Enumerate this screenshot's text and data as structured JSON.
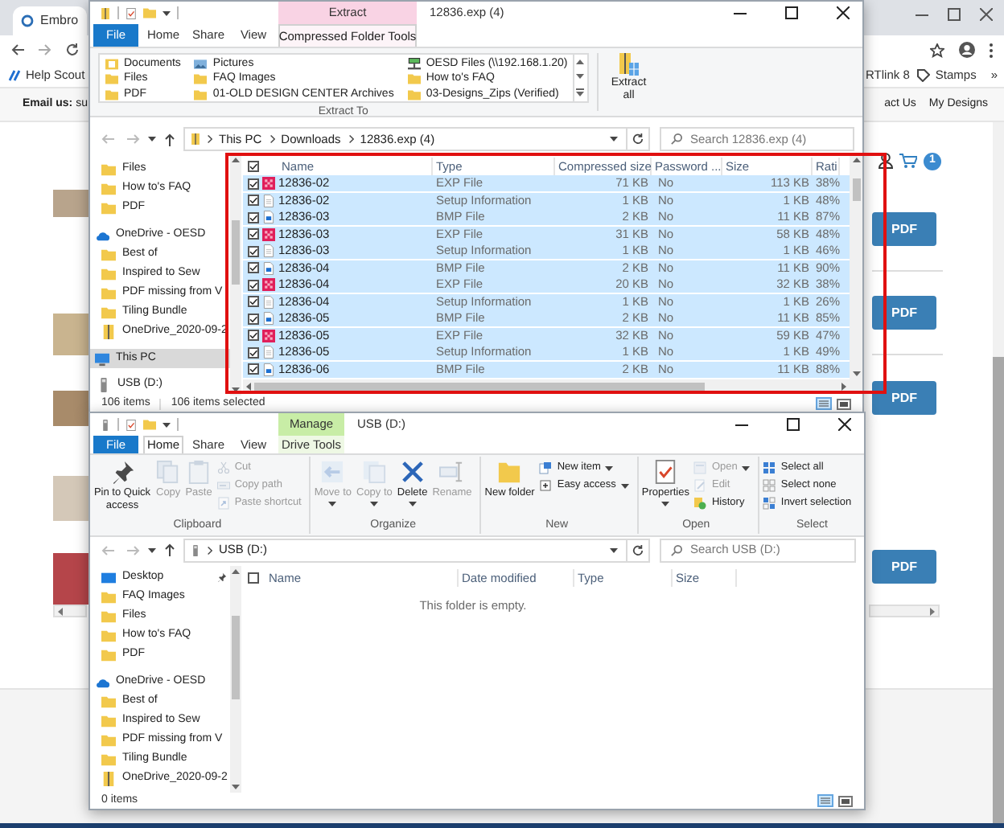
{
  "browser": {
    "tab_title": "Embro",
    "bookmarks_left": [
      "Help Scout"
    ],
    "bookmarks_right": [
      "RTlink 8",
      "Stamps"
    ],
    "bookmarks_more": "»",
    "email_label": "**Email us:** su",
    "nav_links": [
      "act Us",
      "My Designs"
    ],
    "cart_count": "1",
    "pdf_buttons": [
      "PDF",
      "PDF",
      "PDF",
      "PDF"
    ]
  },
  "zip_window": {
    "title": "12836.exp (4)",
    "context_group": "Extract",
    "tabs": [
      {
        "label": "File",
        "kind": "file",
        "selected": false
      },
      {
        "label": "Home",
        "kind": "plain",
        "selected": false
      },
      {
        "label": "Share",
        "kind": "plain",
        "selected": false
      },
      {
        "label": "View",
        "kind": "plain",
        "selected": false
      },
      {
        "label": "Compressed Folder Tools",
        "kind": "context",
        "selected": true
      }
    ],
    "extract_to": [
      {
        "label": "Documents",
        "kind": "documents"
      },
      {
        "label": "Pictures",
        "kind": "pictures"
      },
      {
        "label": "OESD Files (\\\\192.168.1.20)",
        "kind": "network"
      },
      {
        "label": "Files",
        "kind": "folder"
      },
      {
        "label": "FAQ Images",
        "kind": "folder"
      },
      {
        "label": "How to's FAQ",
        "kind": "folder"
      },
      {
        "label": "PDF",
        "kind": "folder"
      },
      {
        "label": "01-OLD DESIGN CENTER Archives",
        "kind": "folder"
      },
      {
        "label": "03-Designs_Zips (Verified)",
        "kind": "folder"
      }
    ],
    "extract_to_label": "Extract To",
    "extract_all": "Extract all",
    "breadcrumb": [
      "This PC",
      "Downloads",
      "12836.exp (4)"
    ],
    "search_placeholder": "Search 12836.exp (4)",
    "nav_items": [
      {
        "label": "Files",
        "kind": "folder",
        "selected": false
      },
      {
        "label": "How to's FAQ",
        "kind": "folder",
        "selected": false
      },
      {
        "label": "PDF",
        "kind": "folder",
        "selected": false
      },
      {
        "label": "OneDrive - OESD",
        "kind": "cloud",
        "selected": false
      },
      {
        "label": "Best of",
        "kind": "folder",
        "selected": false
      },
      {
        "label": "Inspired to Sew",
        "kind": "folder",
        "selected": false
      },
      {
        "label": "PDF missing from V",
        "kind": "folder",
        "selected": false
      },
      {
        "label": "Tiling Bundle",
        "kind": "folder",
        "selected": false
      },
      {
        "label": "OneDrive_2020-09-2",
        "kind": "zip",
        "selected": false
      },
      {
        "label": "This PC",
        "kind": "pc",
        "selected": true
      },
      {
        "label": "USB (D:)",
        "kind": "drive",
        "selected": false
      }
    ],
    "header_checked": true,
    "columns": [
      "Name",
      "Type",
      "Compressed size",
      "Password ...",
      "Size",
      "Rati"
    ],
    "rows": [
      {
        "kind": "exp",
        "name": "12836-02",
        "type": "EXP File",
        "compressed_size": "71 KB",
        "password": "No",
        "size": "113 KB",
        "ratio": "38%",
        "checked": true,
        "selected": true
      },
      {
        "kind": "setup",
        "name": "12836-02",
        "type": "Setup Information",
        "compressed_size": "1 KB",
        "password": "No",
        "size": "1 KB",
        "ratio": "48%",
        "checked": true,
        "selected": true
      },
      {
        "kind": "bmp",
        "name": "12836-03",
        "type": "BMP File",
        "compressed_size": "2 KB",
        "password": "No",
        "size": "11 KB",
        "ratio": "87%",
        "checked": true,
        "selected": true
      },
      {
        "kind": "exp",
        "name": "12836-03",
        "type": "EXP File",
        "compressed_size": "31 KB",
        "password": "No",
        "size": "58 KB",
        "ratio": "48%",
        "checked": true,
        "selected": true
      },
      {
        "kind": "setup",
        "name": "12836-03",
        "type": "Setup Information",
        "compressed_size": "1 KB",
        "password": "No",
        "size": "1 KB",
        "ratio": "46%",
        "checked": true,
        "selected": true
      },
      {
        "kind": "bmp",
        "name": "12836-04",
        "type": "BMP File",
        "compressed_size": "2 KB",
        "password": "No",
        "size": "11 KB",
        "ratio": "90%",
        "checked": true,
        "selected": true
      },
      {
        "kind": "exp",
        "name": "12836-04",
        "type": "EXP File",
        "compressed_size": "20 KB",
        "password": "No",
        "size": "32 KB",
        "ratio": "38%",
        "checked": true,
        "selected": true
      },
      {
        "kind": "setup",
        "name": "12836-04",
        "type": "Setup Information",
        "compressed_size": "1 KB",
        "password": "No",
        "size": "1 KB",
        "ratio": "26%",
        "checked": true,
        "selected": true
      },
      {
        "kind": "bmp",
        "name": "12836-05",
        "type": "BMP File",
        "compressed_size": "2 KB",
        "password": "No",
        "size": "11 KB",
        "ratio": "85%",
        "checked": true,
        "selected": true
      },
      {
        "kind": "exp",
        "name": "12836-05",
        "type": "EXP File",
        "compressed_size": "32 KB",
        "password": "No",
        "size": "59 KB",
        "ratio": "47%",
        "checked": true,
        "selected": true
      },
      {
        "kind": "setup",
        "name": "12836-05",
        "type": "Setup Information",
        "compressed_size": "1 KB",
        "password": "No",
        "size": "1 KB",
        "ratio": "49%",
        "checked": true,
        "selected": true
      },
      {
        "kind": "bmp",
        "name": "12836-06",
        "type": "BMP File",
        "compressed_size": "2 KB",
        "password": "No",
        "size": "11 KB",
        "ratio": "88%",
        "checked": true,
        "selected": true
      }
    ],
    "item_count": "106 items",
    "selected_count": "106 items selected"
  },
  "usb_window": {
    "title": "USB (D:)",
    "context_group": "Manage",
    "tabs": [
      {
        "label": "File",
        "kind": "file",
        "selected": false
      },
      {
        "label": "Home",
        "kind": "plain",
        "selected": true
      },
      {
        "label": "Share",
        "kind": "plain",
        "selected": false
      },
      {
        "label": "View",
        "kind": "plain",
        "selected": false
      },
      {
        "label": "Drive Tools",
        "kind": "context",
        "selected": false
      }
    ],
    "ribbon_groups": [
      {
        "label": "Clipboard",
        "buttons": [
          {
            "label": "Pin to Quick access",
            "kind": "large",
            "disabled": false,
            "dropdown": false
          },
          {
            "label": "Copy",
            "kind": "large",
            "disabled": true,
            "dropdown": false
          },
          {
            "label": "Paste",
            "kind": "large",
            "disabled": true,
            "dropdown": false
          },
          {
            "label": "Cut",
            "kind": "small",
            "disabled": true,
            "dropdown": false
          },
          {
            "label": "Copy path",
            "kind": "small",
            "disabled": true,
            "dropdown": false
          },
          {
            "label": "Paste shortcut",
            "kind": "small",
            "disabled": true,
            "dropdown": false
          }
        ]
      },
      {
        "label": "Organize",
        "buttons": [
          {
            "label": "Move to",
            "kind": "large",
            "disabled": true,
            "dropdown": true
          },
          {
            "label": "Copy to",
            "kind": "large",
            "disabled": true,
            "dropdown": true
          },
          {
            "label": "Delete",
            "kind": "large",
            "disabled": false,
            "dropdown": true
          },
          {
            "label": "Rename",
            "kind": "large",
            "disabled": true,
            "dropdown": false
          }
        ]
      },
      {
        "label": "New",
        "buttons": [
          {
            "label": "New folder",
            "kind": "large",
            "disabled": false,
            "dropdown": false
          },
          {
            "label": "New item",
            "kind": "small",
            "disabled": false,
            "dropdown": true
          },
          {
            "label": "Easy access",
            "kind": "small",
            "disabled": false,
            "dropdown": true
          }
        ]
      },
      {
        "label": "Open",
        "buttons": [
          {
            "label": "Properties",
            "kind": "large",
            "disabled": false,
            "dropdown": true
          },
          {
            "label": "Open",
            "kind": "small",
            "disabled": true,
            "dropdown": true
          },
          {
            "label": "Edit",
            "kind": "small",
            "disabled": true,
            "dropdown": false
          },
          {
            "label": "History",
            "kind": "small",
            "disabled": false,
            "dropdown": false
          }
        ]
      },
      {
        "label": "Select",
        "buttons": [
          {
            "label": "Select all",
            "kind": "small",
            "disabled": false,
            "dropdown": false
          },
          {
            "label": "Select none",
            "kind": "small",
            "disabled": false,
            "dropdown": false
          },
          {
            "label": "Invert selection",
            "kind": "small",
            "disabled": false,
            "dropdown": false
          }
        ]
      }
    ],
    "breadcrumb": [
      "USB (D:)"
    ],
    "search_placeholder": "Search USB (D:)",
    "nav_items": [
      {
        "label": "Desktop",
        "kind": "desktop",
        "selected": false,
        "pinned": true
      },
      {
        "label": "FAQ Images",
        "kind": "folder",
        "selected": false,
        "pinned": false
      },
      {
        "label": "Files",
        "kind": "folder",
        "selected": false,
        "pinned": false
      },
      {
        "label": "How to's FAQ",
        "kind": "folder",
        "selected": false,
        "pinned": false
      },
      {
        "label": "PDF",
        "kind": "folder",
        "selected": false,
        "pinned": false
      },
      {
        "label": "OneDrive - OESD",
        "kind": "cloud",
        "selected": false,
        "pinned": false
      },
      {
        "label": "Best of",
        "kind": "folder",
        "selected": false,
        "pinned": false
      },
      {
        "label": "Inspired to Sew",
        "kind": "folder",
        "selected": false,
        "pinned": false
      },
      {
        "label": "PDF missing from V",
        "kind": "folder",
        "selected": false,
        "pinned": false
      },
      {
        "label": "Tiling Bundle",
        "kind": "folder",
        "selected": false,
        "pinned": false
      },
      {
        "label": "OneDrive_2020-09-2",
        "kind": "zip",
        "selected": false,
        "pinned": false
      }
    ],
    "header_checked": false,
    "columns": [
      "Name",
      "Date modified",
      "Type",
      "Size"
    ],
    "empty_message": "This folder is empty.",
    "item_count": "0 items"
  }
}
